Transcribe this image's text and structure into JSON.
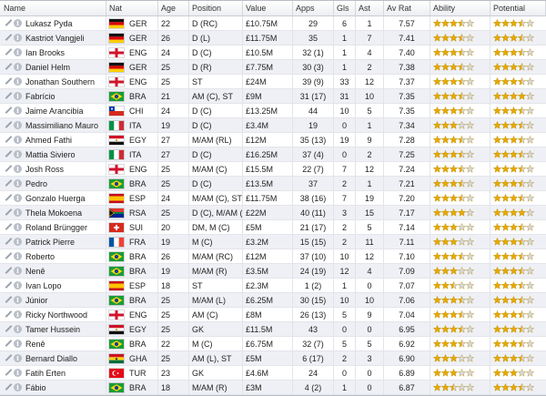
{
  "columns": {
    "name": "Name",
    "nat": "Nat",
    "age": "Age",
    "position": "Position",
    "value": "Value",
    "apps": "Apps",
    "gls": "Gls",
    "ast": "Ast",
    "av_rat": "Av Rat",
    "ability": "Ability",
    "potential": "Potential"
  },
  "icons": {
    "edit": "pencil-icon",
    "info": "info-icon",
    "star": "star-icon"
  },
  "colors": {
    "star_full": "#e6a800",
    "star_empty": "#d6d8dc",
    "header_bg": "#eceef2",
    "row_alt": "#eef0f5"
  },
  "players": [
    {
      "name": "Lukasz Pyda",
      "nat": "GER",
      "age": "22",
      "position": "D (RC)",
      "value": "£10.75M",
      "apps": "29",
      "gls": "6",
      "ast": "1",
      "av_rat": "7.57",
      "ability": 3.5,
      "potential": 3.5
    },
    {
      "name": "Kastriot Vangjeli",
      "nat": "GER",
      "age": "26",
      "position": "D (L)",
      "value": "£11.75M",
      "apps": "35",
      "gls": "1",
      "ast": "7",
      "av_rat": "7.41",
      "ability": 3.5,
      "potential": 3.5
    },
    {
      "name": "Ian Brooks",
      "nat": "ENG",
      "age": "24",
      "position": "D (C)",
      "value": "£10.5M",
      "apps": "32 (1)",
      "gls": "1",
      "ast": "4",
      "av_rat": "7.40",
      "ability": 3.5,
      "potential": 3.5
    },
    {
      "name": "Daniel Helm",
      "nat": "GER",
      "age": "25",
      "position": "D (R)",
      "value": "£7.75M",
      "apps": "30 (3)",
      "gls": "1",
      "ast": "2",
      "av_rat": "7.38",
      "ability": 3.5,
      "potential": 3.5
    },
    {
      "name": "Jonathan Southern",
      "nat": "ENG",
      "age": "25",
      "position": "ST",
      "value": "£24M",
      "apps": "39 (9)",
      "gls": "33",
      "ast": "12",
      "av_rat": "7.37",
      "ability": 3.5,
      "potential": 3.5
    },
    {
      "name": "Fabrício",
      "nat": "BRA",
      "age": "21",
      "position": "AM (C), ST",
      "value": "£9M",
      "apps": "31 (17)",
      "gls": "31",
      "ast": "10",
      "av_rat": "7.35",
      "ability": 3.5,
      "potential": 4
    },
    {
      "name": "Jaime Arancibia",
      "nat": "CHI",
      "age": "24",
      "position": "D (C)",
      "value": "£13.25M",
      "apps": "44",
      "gls": "10",
      "ast": "5",
      "av_rat": "7.35",
      "ability": 3.5,
      "potential": 3.5
    },
    {
      "name": "Massimiliano Mauro",
      "nat": "ITA",
      "age": "19",
      "position": "D (C)",
      "value": "£3.4M",
      "apps": "19",
      "gls": "0",
      "ast": "1",
      "av_rat": "7.34",
      "ability": 3,
      "potential": 3.5
    },
    {
      "name": "Ahmed Fathi",
      "nat": "EGY",
      "age": "27",
      "position": "M/AM (RL)",
      "value": "£12M",
      "apps": "35 (13)",
      "gls": "19",
      "ast": "9",
      "av_rat": "7.28",
      "ability": 3.5,
      "potential": 3.5
    },
    {
      "name": "Mattia Siviero",
      "nat": "ITA",
      "age": "27",
      "position": "D (C)",
      "value": "£16.25M",
      "apps": "37 (4)",
      "gls": "0",
      "ast": "2",
      "av_rat": "7.25",
      "ability": 3.5,
      "potential": 3.5
    },
    {
      "name": "Josh Ross",
      "nat": "ENG",
      "age": "25",
      "position": "M/AM (C)",
      "value": "£15.5M",
      "apps": "22 (7)",
      "gls": "7",
      "ast": "12",
      "av_rat": "7.24",
      "ability": 3.5,
      "potential": 3.5
    },
    {
      "name": "Pedro",
      "nat": "BRA",
      "age": "25",
      "position": "D (C)",
      "value": "£13.5M",
      "apps": "37",
      "gls": "2",
      "ast": "1",
      "av_rat": "7.21",
      "ability": 3.5,
      "potential": 3.5
    },
    {
      "name": "Gonzalo Huerga",
      "nat": "ESP",
      "age": "24",
      "position": "M/AM (C), ST",
      "value": "£11.75M",
      "apps": "38 (16)",
      "gls": "7",
      "ast": "19",
      "av_rat": "7.20",
      "ability": 3.5,
      "potential": 3.5
    },
    {
      "name": "Thela Mokoena",
      "nat": "RSA",
      "age": "25",
      "position": "D (C), M/AM (C)",
      "value": "£22M",
      "apps": "40 (11)",
      "gls": "3",
      "ast": "15",
      "av_rat": "7.17",
      "ability": 4,
      "potential": 4
    },
    {
      "name": "Roland Brüngger",
      "nat": "SUI",
      "age": "20",
      "position": "DM, M (C)",
      "value": "£5M",
      "apps": "21 (17)",
      "gls": "2",
      "ast": "5",
      "av_rat": "7.14",
      "ability": 3,
      "potential": 3.5
    },
    {
      "name": "Patrick Pierre",
      "nat": "FRA",
      "age": "19",
      "position": "M (C)",
      "value": "£3.2M",
      "apps": "15 (15)",
      "gls": "2",
      "ast": "11",
      "av_rat": "7.11",
      "ability": 3,
      "potential": 3.5
    },
    {
      "name": "Roberto",
      "nat": "BRA",
      "age": "26",
      "position": "M/AM (RC)",
      "value": "£12M",
      "apps": "37 (10)",
      "gls": "10",
      "ast": "12",
      "av_rat": "7.10",
      "ability": 3.5,
      "potential": 3.5
    },
    {
      "name": "Nenê",
      "nat": "BRA",
      "age": "19",
      "position": "M/AM (R)",
      "value": "£3.5M",
      "apps": "24 (19)",
      "gls": "12",
      "ast": "4",
      "av_rat": "7.09",
      "ability": 3,
      "potential": 3.5
    },
    {
      "name": "Ivan Lopo",
      "nat": "ESP",
      "age": "18",
      "position": "ST",
      "value": "£2.3M",
      "apps": "1 (2)",
      "gls": "1",
      "ast": "0",
      "av_rat": "7.07",
      "ability": 2.5,
      "potential": 3.5
    },
    {
      "name": "Júnior",
      "nat": "BRA",
      "age": "25",
      "position": "M/AM (L)",
      "value": "£6.25M",
      "apps": "30 (15)",
      "gls": "10",
      "ast": "10",
      "av_rat": "7.06",
      "ability": 3.5,
      "potential": 3.5
    },
    {
      "name": "Ricky Northwood",
      "nat": "ENG",
      "age": "25",
      "position": "AM (C)",
      "value": "£8M",
      "apps": "26 (13)",
      "gls": "5",
      "ast": "9",
      "av_rat": "7.04",
      "ability": 3.5,
      "potential": 3.5
    },
    {
      "name": "Tamer Hussein",
      "nat": "EGY",
      "age": "25",
      "position": "GK",
      "value": "£11.5M",
      "apps": "43",
      "gls": "0",
      "ast": "0",
      "av_rat": "6.95",
      "ability": 3.5,
      "potential": 3.5
    },
    {
      "name": "Renê",
      "nat": "BRA",
      "age": "22",
      "position": "M (C)",
      "value": "£6.75M",
      "apps": "32 (7)",
      "gls": "5",
      "ast": "5",
      "av_rat": "6.92",
      "ability": 3.5,
      "potential": 3.5
    },
    {
      "name": "Bernard Diallo",
      "nat": "GHA",
      "age": "25",
      "position": "AM (L), ST",
      "value": "£5M",
      "apps": "6 (17)",
      "gls": "2",
      "ast": "3",
      "av_rat": "6.90",
      "ability": 3,
      "potential": 3.5
    },
    {
      "name": "Fatih Erten",
      "nat": "TUR",
      "age": "23",
      "position": "GK",
      "value": "£4.6M",
      "apps": "24",
      "gls": "0",
      "ast": "0",
      "av_rat": "6.89",
      "ability": 3,
      "potential": 3
    },
    {
      "name": "Fábio",
      "nat": "BRA",
      "age": "18",
      "position": "M/AM (R)",
      "value": "£3M",
      "apps": "4 (2)",
      "gls": "1",
      "ast": "0",
      "av_rat": "6.87",
      "ability": 2.5,
      "potential": 3.5
    }
  ]
}
